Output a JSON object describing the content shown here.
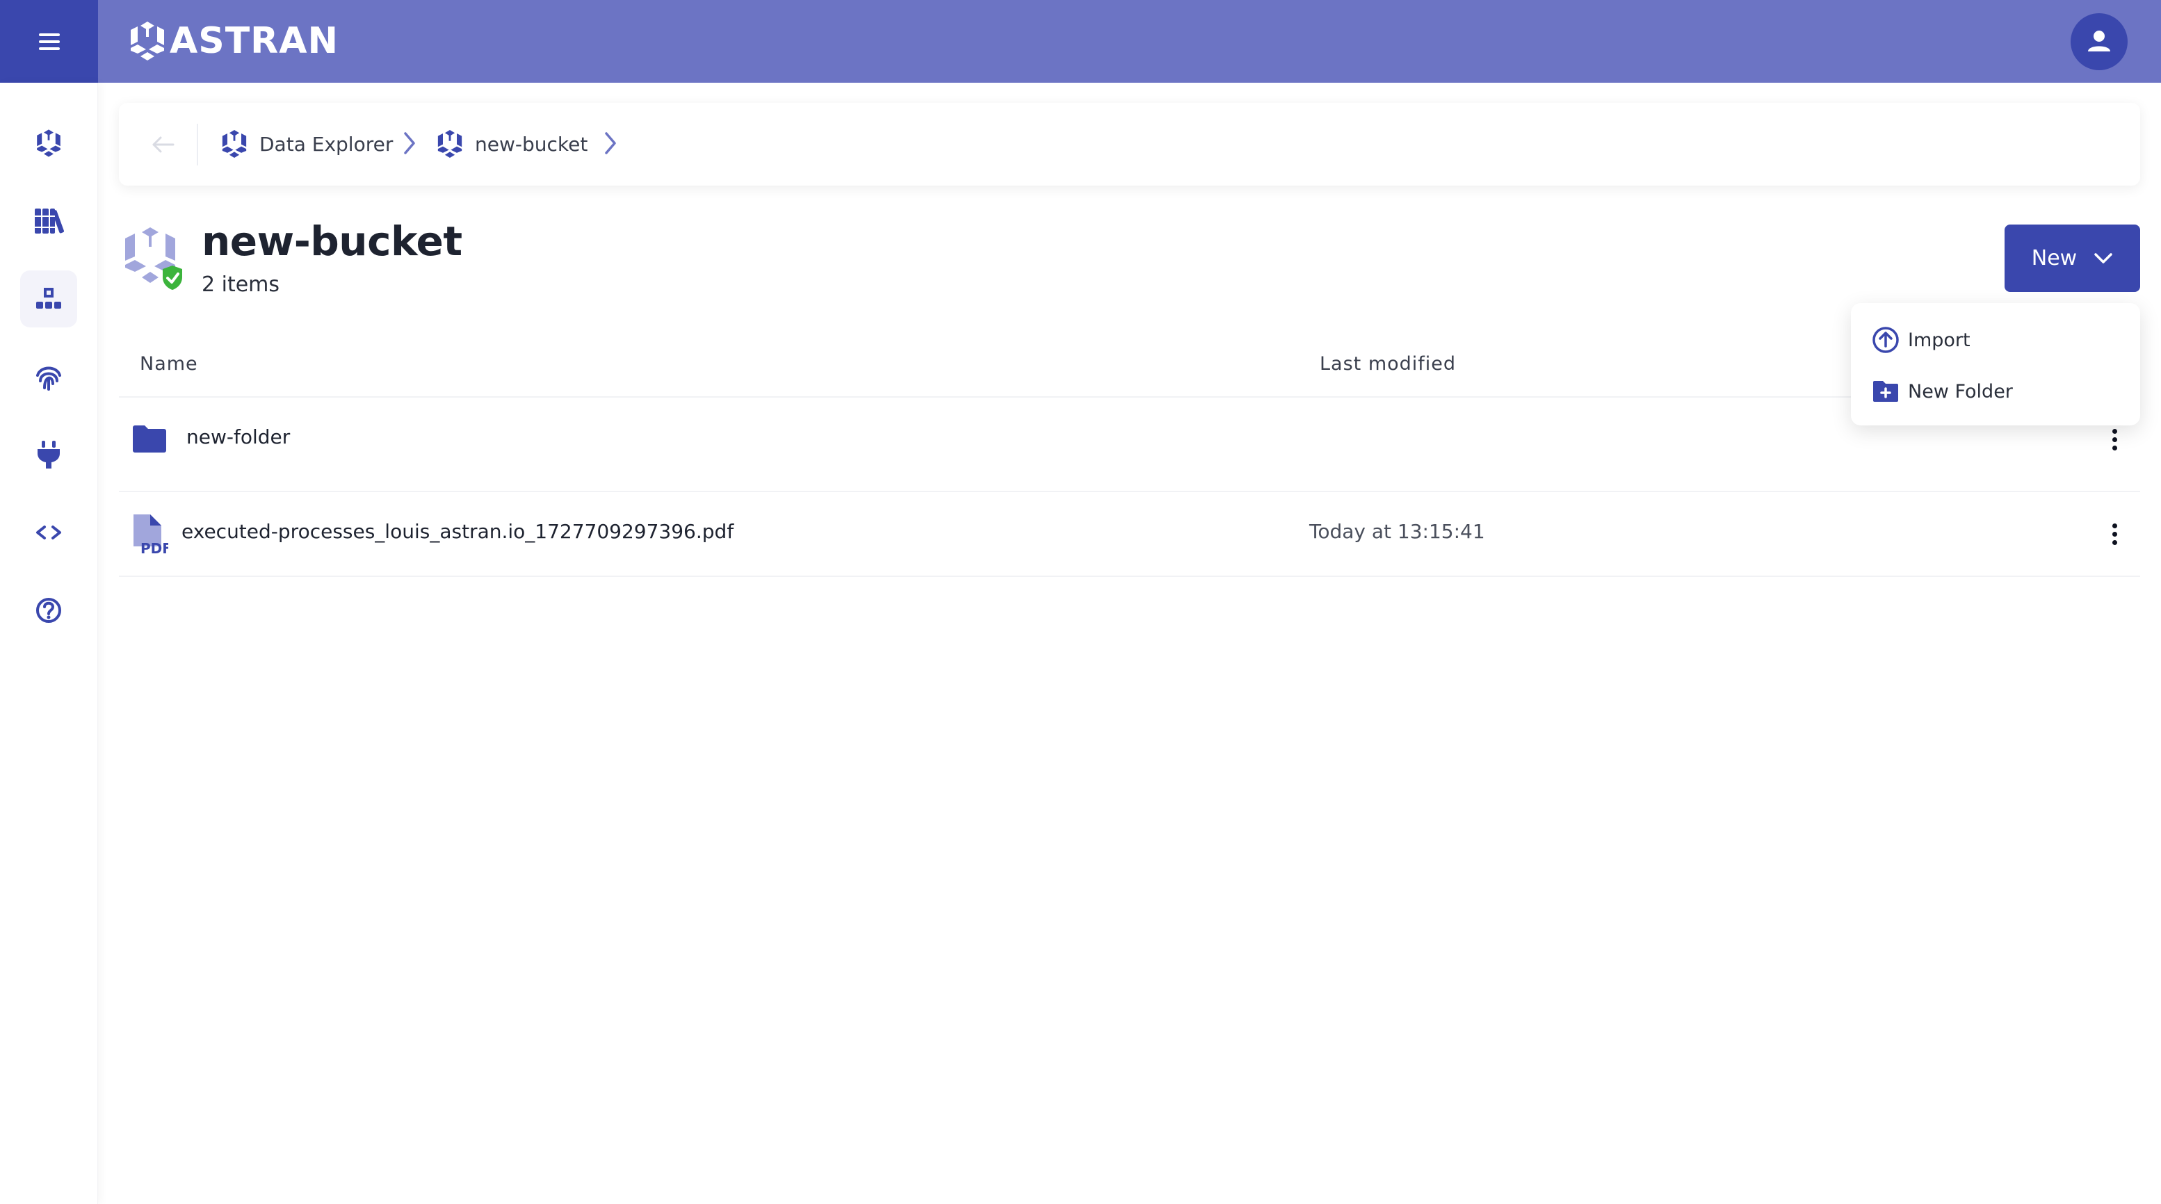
{
  "header": {
    "brand": "ASTRAN",
    "menu_icon": "hamburger-icon",
    "avatar_icon": "user-icon"
  },
  "colors": {
    "header_bg": "#6c74c4",
    "primary": "#3a47ad",
    "success": "#3cb43c",
    "text": "#1e2330"
  },
  "sidebar": {
    "items": [
      {
        "icon": "astran-logo-icon",
        "active": false
      },
      {
        "icon": "library-icon",
        "active": false
      },
      {
        "icon": "data-explorer-icon",
        "active": true
      },
      {
        "icon": "fingerprint-icon",
        "active": false
      },
      {
        "icon": "plug-icon",
        "active": false
      },
      {
        "icon": "code-icon",
        "active": false
      },
      {
        "icon": "help-icon",
        "active": false
      }
    ]
  },
  "breadcrumb": {
    "back_icon": "arrow-left-icon",
    "items": [
      {
        "label": "Data Explorer",
        "icon": "astran-logo-icon"
      },
      {
        "label": "new-bucket",
        "icon": "astran-logo-icon"
      }
    ]
  },
  "page": {
    "title": "new-bucket",
    "count": "2 items",
    "status_icon": "shield-check-icon"
  },
  "new_button": {
    "label": "New",
    "icon": "chevron-down-icon"
  },
  "new_menu": {
    "items": [
      {
        "label": "Import",
        "icon": "upload-circle-icon"
      },
      {
        "label": "New Folder",
        "icon": "folder-plus-icon"
      }
    ]
  },
  "table": {
    "columns": [
      "Name",
      "Last modified"
    ],
    "rows": [
      {
        "name": "new-folder",
        "type": "folder",
        "modified": ""
      },
      {
        "name": "executed-processes_louis_astran.io_1727709297396.pdf",
        "type": "pdf",
        "modified": "Today at 13:15:41"
      }
    ]
  }
}
